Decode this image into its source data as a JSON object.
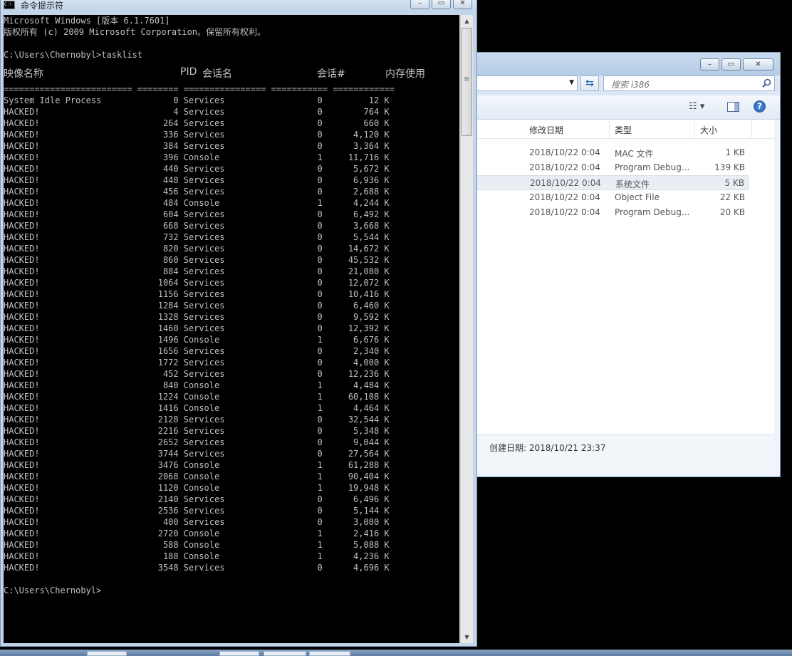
{
  "cmd": {
    "title": "命令提示符",
    "banner1": "Microsoft Windows [版本 6.1.7601]",
    "banner2": "版权所有 (c) 2009 Microsoft Corporation。保留所有权利。",
    "prompt1": "C:\\Users\\Chernobyl>tasklist",
    "headers": {
      "image": "映像名称",
      "pid": "PID",
      "session": "会话名",
      "sessnum": "会话#",
      "mem": "内存使用"
    },
    "separator": "========================= ======== ================ =========== ============",
    "processes": [
      {
        "name": "System Idle Process",
        "pid": "0",
        "session": "Services",
        "num": "0",
        "mem": "12 K"
      },
      {
        "name": "HACKED!",
        "pid": "4",
        "session": "Services",
        "num": "0",
        "mem": "764 K"
      },
      {
        "name": "HACKED!",
        "pid": "264",
        "session": "Services",
        "num": "0",
        "mem": "660 K"
      },
      {
        "name": "HACKED!",
        "pid": "336",
        "session": "Services",
        "num": "0",
        "mem": "4,120 K"
      },
      {
        "name": "HACKED!",
        "pid": "384",
        "session": "Services",
        "num": "0",
        "mem": "3,364 K"
      },
      {
        "name": "HACKED!",
        "pid": "396",
        "session": "Console",
        "num": "1",
        "mem": "11,716 K"
      },
      {
        "name": "HACKED!",
        "pid": "440",
        "session": "Services",
        "num": "0",
        "mem": "5,672 K"
      },
      {
        "name": "HACKED!",
        "pid": "448",
        "session": "Services",
        "num": "0",
        "mem": "6,936 K"
      },
      {
        "name": "HACKED!",
        "pid": "456",
        "session": "Services",
        "num": "0",
        "mem": "2,688 K"
      },
      {
        "name": "HACKED!",
        "pid": "484",
        "session": "Console",
        "num": "1",
        "mem": "4,244 K"
      },
      {
        "name": "HACKED!",
        "pid": "604",
        "session": "Services",
        "num": "0",
        "mem": "6,492 K"
      },
      {
        "name": "HACKED!",
        "pid": "668",
        "session": "Services",
        "num": "0",
        "mem": "3,668 K"
      },
      {
        "name": "HACKED!",
        "pid": "732",
        "session": "Services",
        "num": "0",
        "mem": "5,544 K"
      },
      {
        "name": "HACKED!",
        "pid": "820",
        "session": "Services",
        "num": "0",
        "mem": "14,672 K"
      },
      {
        "name": "HACKED!",
        "pid": "860",
        "session": "Services",
        "num": "0",
        "mem": "45,532 K"
      },
      {
        "name": "HACKED!",
        "pid": "884",
        "session": "Services",
        "num": "0",
        "mem": "21,080 K"
      },
      {
        "name": "HACKED!",
        "pid": "1064",
        "session": "Services",
        "num": "0",
        "mem": "12,072 K"
      },
      {
        "name": "HACKED!",
        "pid": "1156",
        "session": "Services",
        "num": "0",
        "mem": "10,416 K"
      },
      {
        "name": "HACKED!",
        "pid": "1284",
        "session": "Services",
        "num": "0",
        "mem": "6,460 K"
      },
      {
        "name": "HACKED!",
        "pid": "1328",
        "session": "Services",
        "num": "0",
        "mem": "9,592 K"
      },
      {
        "name": "HACKED!",
        "pid": "1460",
        "session": "Services",
        "num": "0",
        "mem": "12,392 K"
      },
      {
        "name": "HACKED!",
        "pid": "1496",
        "session": "Console",
        "num": "1",
        "mem": "6,676 K"
      },
      {
        "name": "HACKED!",
        "pid": "1656",
        "session": "Services",
        "num": "0",
        "mem": "2,340 K"
      },
      {
        "name": "HACKED!",
        "pid": "1772",
        "session": "Services",
        "num": "0",
        "mem": "4,000 K"
      },
      {
        "name": "HACKED!",
        "pid": "452",
        "session": "Services",
        "num": "0",
        "mem": "12,236 K"
      },
      {
        "name": "HACKED!",
        "pid": "840",
        "session": "Console",
        "num": "1",
        "mem": "4,484 K"
      },
      {
        "name": "HACKED!",
        "pid": "1224",
        "session": "Console",
        "num": "1",
        "mem": "60,108 K"
      },
      {
        "name": "HACKED!",
        "pid": "1416",
        "session": "Console",
        "num": "1",
        "mem": "4,464 K"
      },
      {
        "name": "HACKED!",
        "pid": "2128",
        "session": "Services",
        "num": "0",
        "mem": "32,544 K"
      },
      {
        "name": "HACKED!",
        "pid": "2216",
        "session": "Services",
        "num": "0",
        "mem": "5,348 K"
      },
      {
        "name": "HACKED!",
        "pid": "2652",
        "session": "Services",
        "num": "0",
        "mem": "9,044 K"
      },
      {
        "name": "HACKED!",
        "pid": "3744",
        "session": "Services",
        "num": "0",
        "mem": "27,564 K"
      },
      {
        "name": "HACKED!",
        "pid": "3476",
        "session": "Console",
        "num": "1",
        "mem": "61,288 K"
      },
      {
        "name": "HACKED!",
        "pid": "2068",
        "session": "Console",
        "num": "1",
        "mem": "90,404 K"
      },
      {
        "name": "HACKED!",
        "pid": "1120",
        "session": "Console",
        "num": "1",
        "mem": "19,948 K"
      },
      {
        "name": "HACKED!",
        "pid": "2140",
        "session": "Services",
        "num": "0",
        "mem": "6,496 K"
      },
      {
        "name": "HACKED!",
        "pid": "2536",
        "session": "Services",
        "num": "0",
        "mem": "5,144 K"
      },
      {
        "name": "HACKED!",
        "pid": "400",
        "session": "Services",
        "num": "0",
        "mem": "3,000 K"
      },
      {
        "name": "HACKED!",
        "pid": "2720",
        "session": "Console",
        "num": "1",
        "mem": "2,416 K"
      },
      {
        "name": "HACKED!",
        "pid": "588",
        "session": "Console",
        "num": "1",
        "mem": "5,088 K"
      },
      {
        "name": "HACKED!",
        "pid": "188",
        "session": "Console",
        "num": "1",
        "mem": "4,236 K"
      },
      {
        "name": "HACKED!",
        "pid": "3548",
        "session": "Services",
        "num": "0",
        "mem": "4,696 K"
      }
    ],
    "prompt2": "C:\\Users\\Chernobyl>"
  },
  "explorer": {
    "search_placeholder": "搜索 i386",
    "columns": {
      "date": "修改日期",
      "type": "类型",
      "size": "大小"
    },
    "files": [
      {
        "date": "2018/10/22 0:04",
        "type": "MAC 文件",
        "size": "1 KB"
      },
      {
        "date": "2018/10/22 0:04",
        "type": "Program Debug...",
        "size": "139 KB"
      },
      {
        "date": "2018/10/22 0:04",
        "type": "系统文件",
        "size": "5 KB",
        "selected": true
      },
      {
        "date": "2018/10/22 0:04",
        "type": "Object File",
        "size": "22 KB"
      },
      {
        "date": "2018/10/22 0:04",
        "type": "Program Debug...",
        "size": "20 KB"
      }
    ],
    "details": "创建日期: 2018/10/21 23:37"
  },
  "icons": [
    "cmd-icon",
    "minimize-icon",
    "maximize-icon",
    "close-icon",
    "refresh-icon",
    "search-icon",
    "views-icon",
    "preview-pane-icon",
    "help-icon"
  ]
}
